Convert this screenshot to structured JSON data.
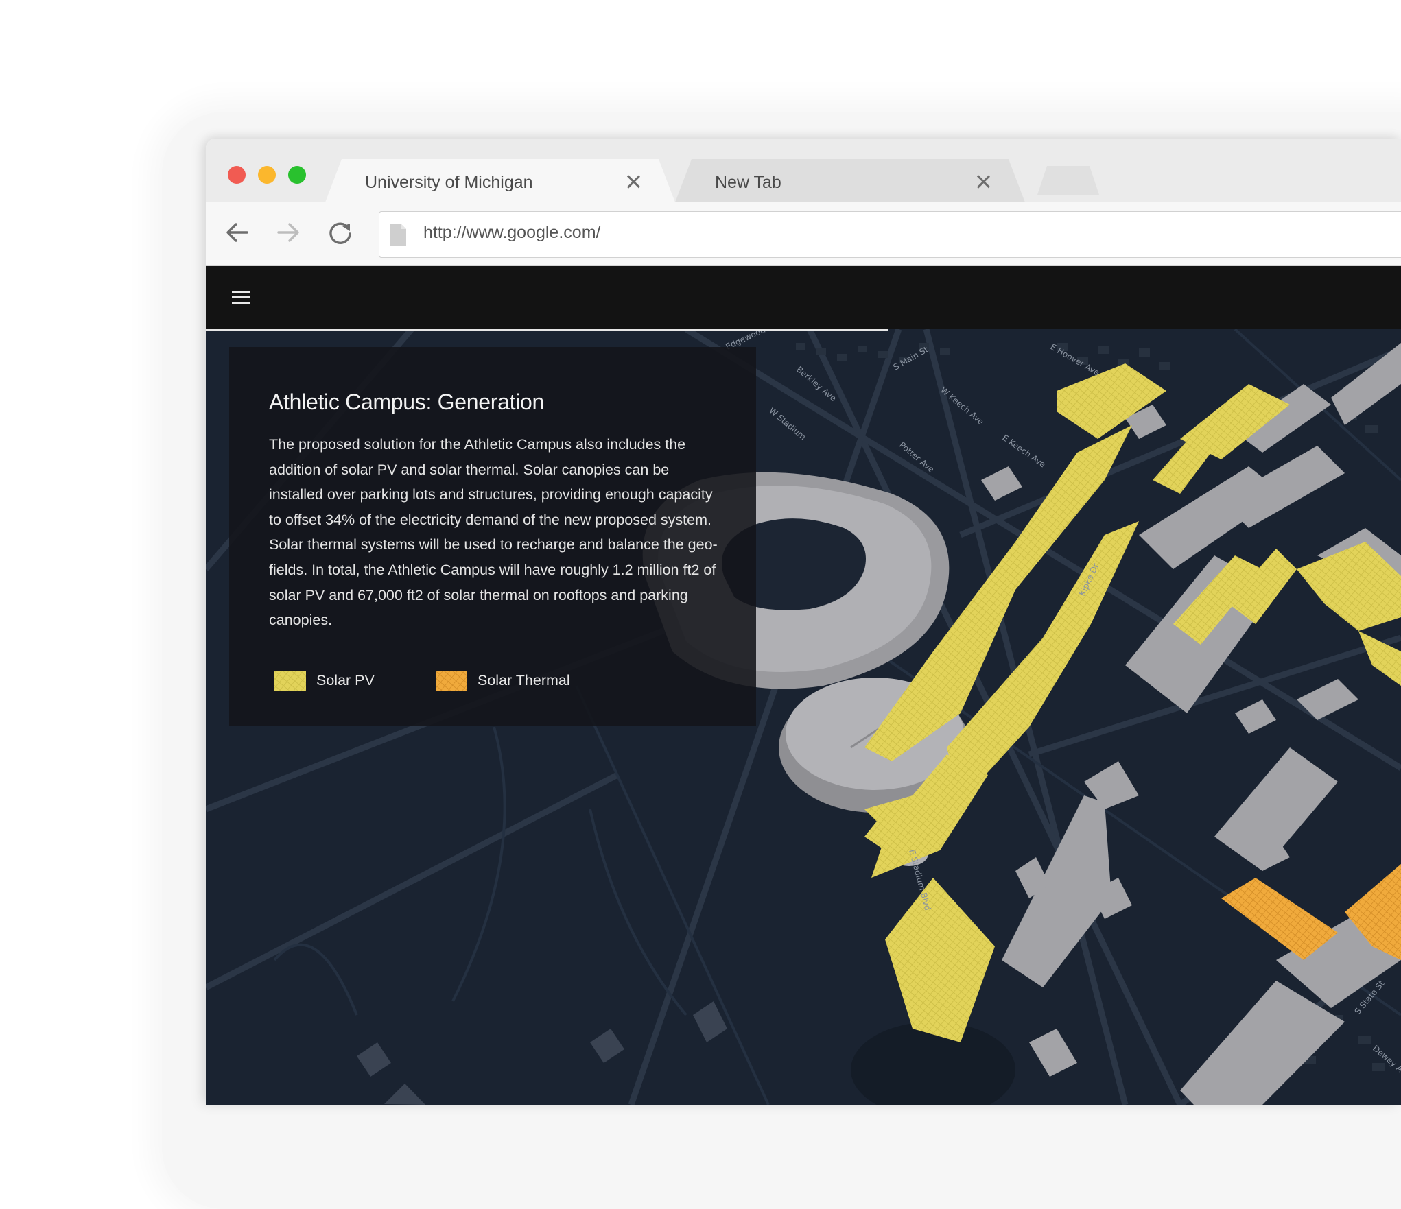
{
  "browser": {
    "tabs": [
      {
        "label": "University of Michigan",
        "active": true
      },
      {
        "label": "New Tab",
        "active": false
      }
    ],
    "address_bar": {
      "url": "http://www.google.com/"
    }
  },
  "header": {
    "menu_icon": "hamburger-menu-icon"
  },
  "info_panel": {
    "title": "Athletic Campus: Generation",
    "body": "The proposed solution for the Athletic Campus also includes the addition of solar PV and solar thermal. Solar canopies can be installed over parking lots and structures, providing enough capacity to offset 34% of the electricity demand of the new proposed system. Solar thermal systems will be used to recharge and balance the geo-fields. In total, the Athletic Campus will have roughly 1.2 million ft2 of solar PV and 67,000 ft2 of solar thermal on rooftops and parking canopies.",
    "legend": [
      {
        "label": "Solar PV",
        "color": "#e6d858"
      },
      {
        "label": "Solar Thermal",
        "color": "#f0a93a"
      }
    ]
  },
  "map": {
    "streets": [
      "S Main St",
      "E Hoover Ave",
      "E Keech Ave",
      "Kipke Dr",
      "E Stadium Blvd",
      "Potter Ave",
      "W Keech Ave",
      "S State St",
      "Dewey Ave",
      "Edgewood",
      "Berkley Ave",
      "W Stadium"
    ],
    "colors": {
      "background": "#1a2331",
      "buildings": "#a3a3a7",
      "solar_pv": "#e2d35a",
      "solar_thermal": "#f0aa3c"
    }
  }
}
